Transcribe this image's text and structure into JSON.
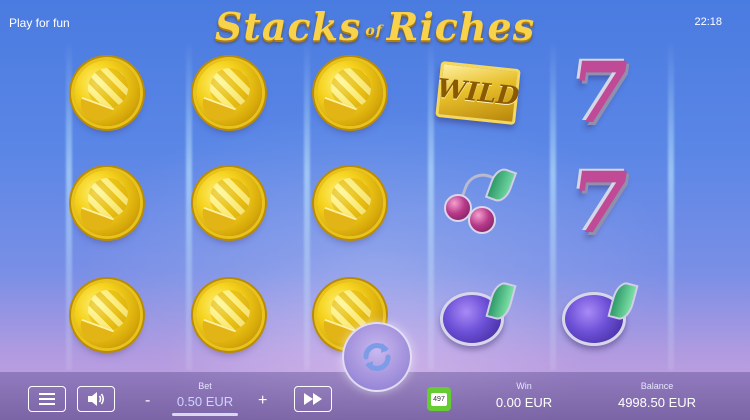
{
  "header": {
    "mode_label": "Play for fun",
    "clock": "22:18",
    "logo_main": "Stacks",
    "logo_of": "of",
    "logo_end": "Riches"
  },
  "reels": {
    "symbols": [
      [
        "gold-coin",
        "gold-coin",
        "gold-coin"
      ],
      [
        "gold-coin",
        "gold-coin",
        "gold-coin"
      ],
      [
        "gold-coin",
        "gold-coin",
        "gold-coin"
      ],
      [
        "wild",
        "cherry",
        "plum"
      ],
      [
        "seven",
        "seven",
        "plum"
      ]
    ],
    "wild_label": "WILD",
    "seven_label": "7"
  },
  "bottom": {
    "bet_label": "Bet",
    "bet_value": "0.50 EUR",
    "minus": "-",
    "plus": "+",
    "win_label": "Win",
    "win_value": "0.00 EUR",
    "balance_label": "Balance",
    "balance_value": "4998.50 EUR",
    "autoplay_count": "497"
  },
  "colors": {
    "coin_gold": "#f5d21c",
    "seven_pink": "#c04a95",
    "plum_purple": "#6b4fd6",
    "autoplay_green": "#66cc33"
  }
}
